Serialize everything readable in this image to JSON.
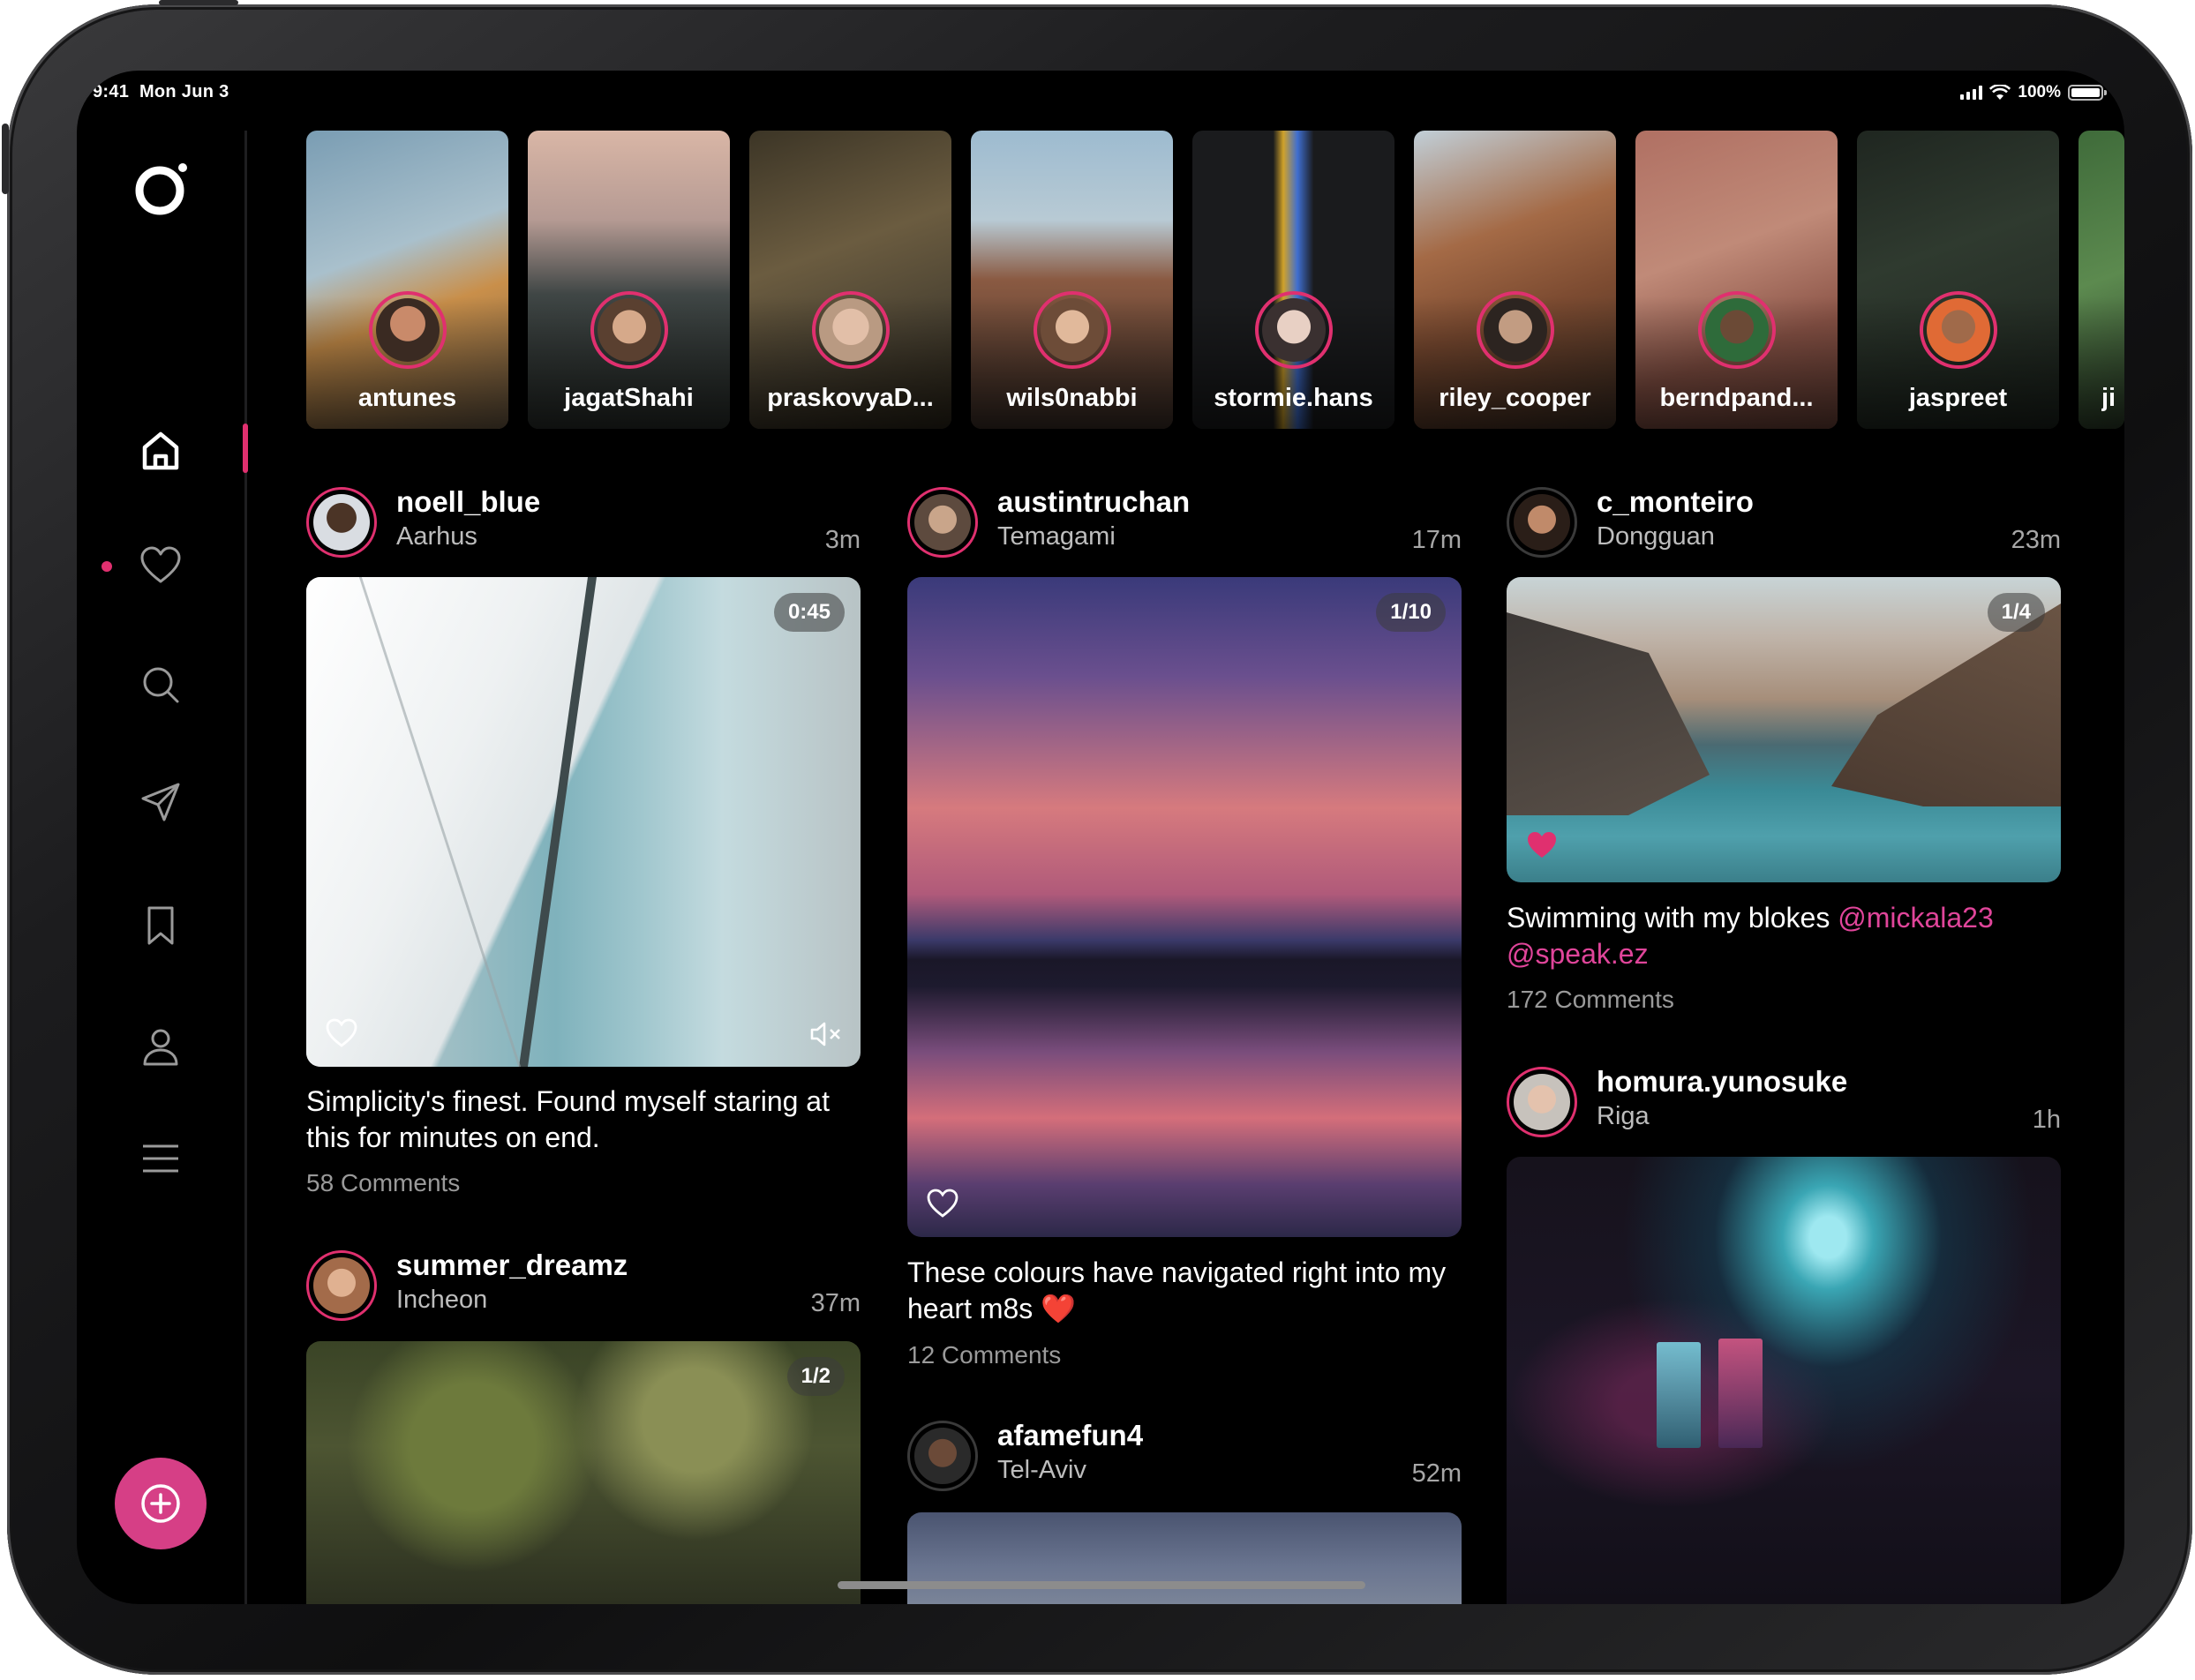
{
  "status_bar": {
    "time": "9:41",
    "date": "Mon Jun 3",
    "battery": "100%"
  },
  "sidebar": {
    "items": [
      {
        "icon": "home-icon",
        "label": "Home",
        "active": true
      },
      {
        "icon": "heart-icon",
        "label": "Activity",
        "has_notification": true
      },
      {
        "icon": "search-icon",
        "label": "Search"
      },
      {
        "icon": "send-icon",
        "label": "Messages"
      },
      {
        "icon": "bookmark-icon",
        "label": "Saved"
      },
      {
        "icon": "profile-icon",
        "label": "Profile"
      },
      {
        "icon": "menu-icon",
        "label": "Menu"
      }
    ],
    "fab_icon": "plus-circle-icon"
  },
  "stories": [
    {
      "name": "antunes"
    },
    {
      "name": "jagatShahi"
    },
    {
      "name": "praskovyaD..."
    },
    {
      "name": "wils0nabbi"
    },
    {
      "name": "stormie.hans"
    },
    {
      "name": "riley_cooper"
    },
    {
      "name": "berndpand..."
    },
    {
      "name": "jaspreet"
    },
    {
      "name": "ji"
    }
  ],
  "posts": {
    "noell": {
      "user": "noell_blue",
      "location": "Aarhus",
      "ago": "3m",
      "counter": "0:45",
      "caption": "Simplicity's finest. Found myself staring at this for minutes on end.",
      "comments": "58 Comments"
    },
    "summer": {
      "user": "summer_dreamz",
      "location": "Incheon",
      "ago": "37m",
      "counter": "1/2"
    },
    "austin": {
      "user": "austintruchan",
      "location": "Temagami",
      "ago": "17m",
      "counter": "1/10",
      "caption": "These colours have navigated right into my heart m8s",
      "emoji": "❤️",
      "comments": "12 Comments"
    },
    "afame": {
      "user": "afamefun4",
      "location": "Tel-Aviv",
      "ago": "52m"
    },
    "monteiro": {
      "user": "c_monteiro",
      "location": "Dongguan",
      "ago": "23m",
      "counter": "1/4",
      "caption": "Swimming with my blokes",
      "mention1": "@mickala23",
      "mention2": "@speak.ez",
      "comments": "172 Comments"
    },
    "homura": {
      "user": "homura.yunosuke",
      "location": "Riga",
      "ago": "1h"
    }
  },
  "colors": {
    "accent": "#e0306f",
    "fab": "#d63f86",
    "background": "#000000"
  }
}
